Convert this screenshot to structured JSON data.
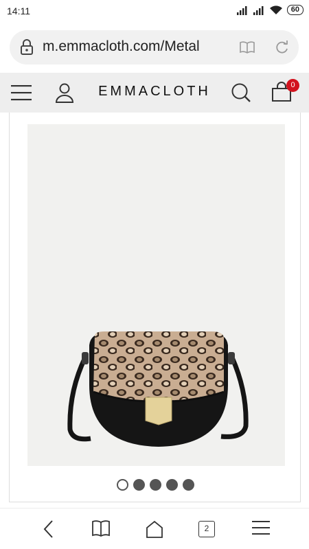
{
  "status_bar": {
    "time": "14:11",
    "battery": "60"
  },
  "browser": {
    "url": "m.emmacloth.com/Metal"
  },
  "site_header": {
    "logo": "EMMACLOTH",
    "cart_count": "0"
  },
  "gallery": {
    "image_count": 5,
    "active_index": 0
  },
  "bottom_nav": {
    "tab_count": "2"
  }
}
